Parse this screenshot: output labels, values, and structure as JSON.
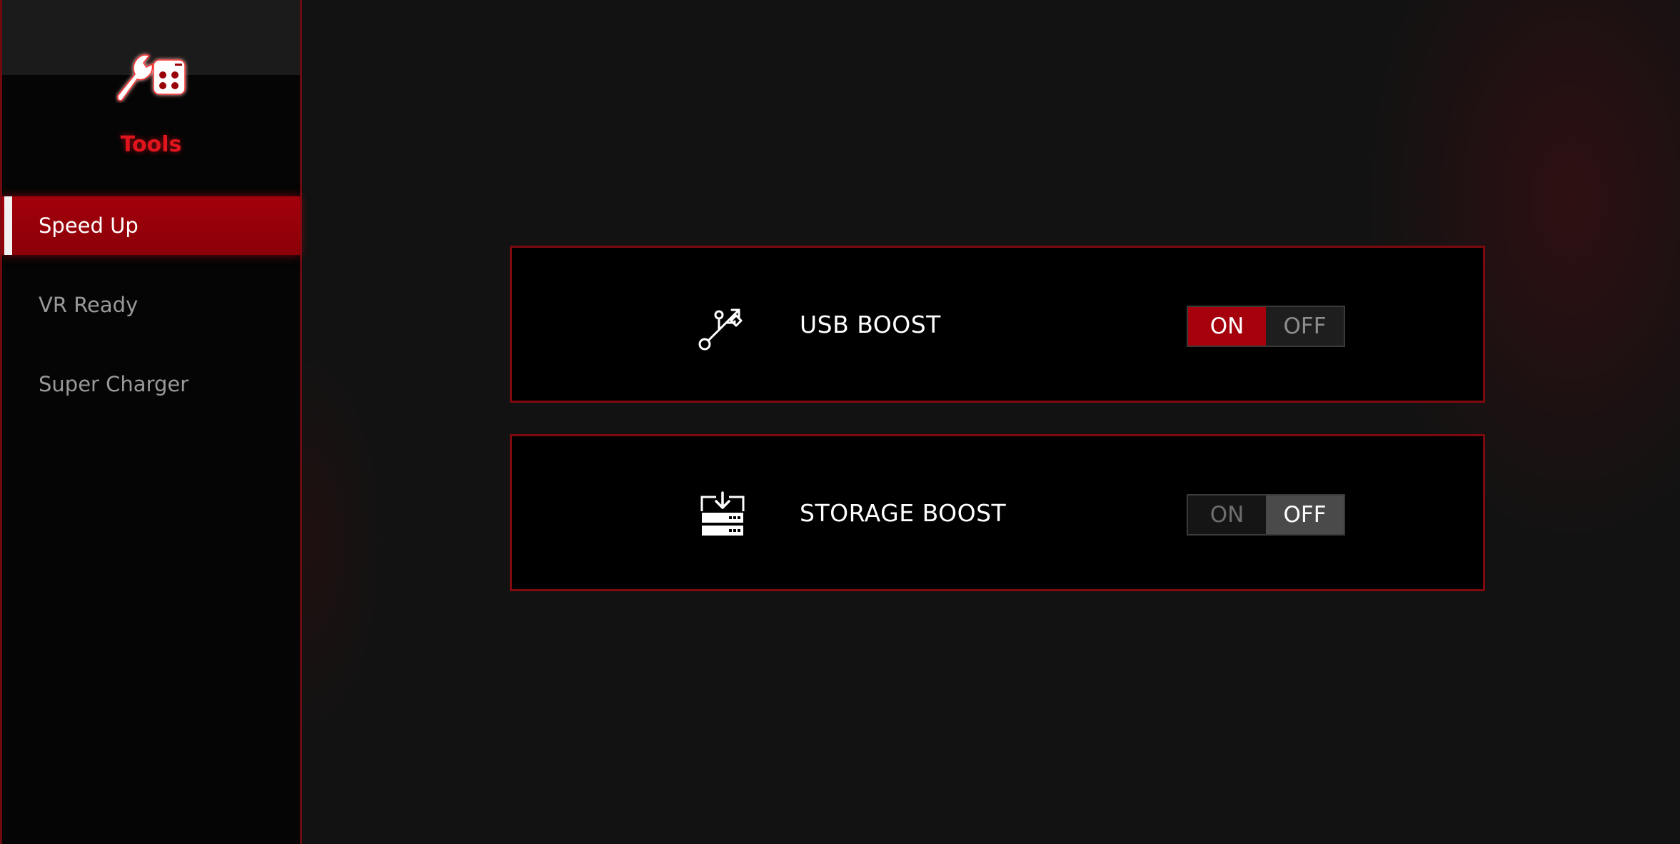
{
  "sidebar": {
    "title": "Tools",
    "icon": "tools-wrench-icon",
    "items": [
      {
        "label": "Speed Up",
        "active": true
      },
      {
        "label": "VR Ready",
        "active": false
      },
      {
        "label": "Super Charger",
        "active": false
      }
    ]
  },
  "features": [
    {
      "label": "USB BOOST",
      "icon": "usb-icon",
      "on_label": "ON",
      "off_label": "OFF",
      "state": "ON"
    },
    {
      "label": "STORAGE BOOST",
      "icon": "storage-drive-icon",
      "on_label": "ON",
      "off_label": "OFF",
      "state": "OFF"
    }
  ],
  "colors": {
    "accent": "#a5000c",
    "title": "#e0141c",
    "border": "#7e0a10"
  }
}
